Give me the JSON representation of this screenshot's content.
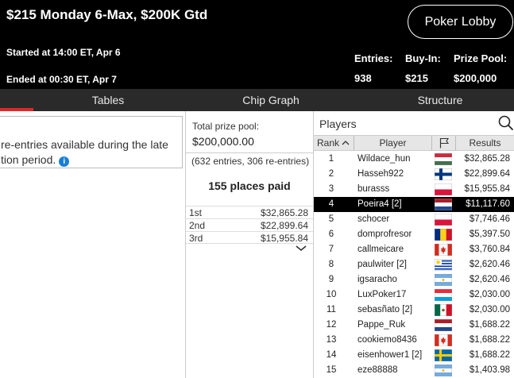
{
  "header": {
    "title": "$215 Monday 6-Max, $200K Gtd",
    "lobby_button": "Poker Lobby",
    "started": "Started at 14:00 ET, Apr 6",
    "ended": "Ended at 00:30 ET, Apr 7",
    "entries_label": "Entries:",
    "entries_value": "938",
    "buyin_label": "Buy-In:",
    "buyin_value": "$215",
    "prize_label": "Prize Pool:",
    "prize_value": "$200,000"
  },
  "tabs": [
    {
      "label": "Tables",
      "active": true
    },
    {
      "label": "Chip Graph",
      "active": false
    },
    {
      "label": "Structure",
      "active": false
    }
  ],
  "accent_color": "#e0262b",
  "info_box": {
    "line1": "re-entries available during the late",
    "line2": "tion period.",
    "icon": "info-icon"
  },
  "prize_panel": {
    "pool_label": "Total prize pool:",
    "pool_value": "$200,000.00",
    "entries_detail": "(632 entries, 306 re-entries)",
    "places_paid": "155 places paid",
    "payouts": [
      {
        "place": "1st",
        "amount": "$32,865.28"
      },
      {
        "place": "2nd",
        "amount": "$22,899.64"
      },
      {
        "place": "3rd",
        "amount": "$15,955.84"
      }
    ],
    "expand_icon": "chevron-down-icon"
  },
  "players": {
    "title": "Players",
    "search_icon": "search-icon",
    "columns": {
      "rank": "Rank",
      "player": "Player",
      "flag": "flag-icon",
      "results": "Results"
    },
    "selected_rank": "4",
    "rows": [
      {
        "rank": "1",
        "name": "Wildace_hun",
        "country": "hungary",
        "result": "$32,865.28"
      },
      {
        "rank": "2",
        "name": "Hasseh922",
        "country": "finland",
        "result": "$22,899.64"
      },
      {
        "rank": "3",
        "name": "burasss",
        "country": "poland",
        "result": "$15,955.84"
      },
      {
        "rank": "4",
        "name": "Poeira4 [2]",
        "country": "netherlands",
        "result": "$11,117.60"
      },
      {
        "rank": "5",
        "name": "schocer",
        "country": "poland",
        "result": "$7,746.46"
      },
      {
        "rank": "6",
        "name": "domprofresor",
        "country": "romania",
        "result": "$5,397.50"
      },
      {
        "rank": "7",
        "name": "callmeicare",
        "country": "canada",
        "result": "$3,760.84"
      },
      {
        "rank": "8",
        "name": "paulwiter [2]",
        "country": "uruguay",
        "result": "$2,620.46"
      },
      {
        "rank": "9",
        "name": "igsaracho",
        "country": "argentina",
        "result": "$2,620.46"
      },
      {
        "rank": "10",
        "name": "LuxPoker17",
        "country": "luxembourg",
        "result": "$2,030.00"
      },
      {
        "rank": "11",
        "name": "sebasñato [2]",
        "country": "mexico",
        "result": "$2,030.00"
      },
      {
        "rank": "12",
        "name": "Pappe_Ruk",
        "country": "netherlands",
        "result": "$1,688.22"
      },
      {
        "rank": "13",
        "name": "cookiemo8436",
        "country": "canada",
        "result": "$1,688.22"
      },
      {
        "rank": "14",
        "name": "eisenhower1 [2]",
        "country": "sweden",
        "result": "$1,688.22"
      },
      {
        "rank": "15",
        "name": "eze88888",
        "country": "argentina",
        "result": "$1,403.98"
      }
    ]
  }
}
